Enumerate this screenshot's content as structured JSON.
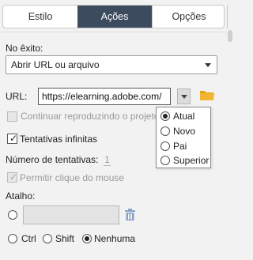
{
  "tabs": [
    {
      "label": "Estilo"
    },
    {
      "label": "Ações"
    },
    {
      "label": "Opções"
    }
  ],
  "on_success": {
    "label": "No êxito:",
    "selected": "Abrir URL ou arquivo"
  },
  "url": {
    "label": "URL:",
    "value": "https://elearning.adobe.com/"
  },
  "continue_playing": {
    "label": "Continuar reproduzindo o projeto"
  },
  "infinite_attempts": {
    "label": "Tentativas infinitas"
  },
  "attempts": {
    "label": "Número de tentativas:",
    "value": "1"
  },
  "allow_mouse_click": {
    "label": "Permitir clique do mouse"
  },
  "shortcut": {
    "label": "Atalho:",
    "modifiers": [
      {
        "label": "Ctrl"
      },
      {
        "label": "Shift"
      },
      {
        "label": "Nenhuma"
      }
    ]
  },
  "window_popup": {
    "options": [
      {
        "label": "Atual"
      },
      {
        "label": "Novo"
      },
      {
        "label": "Pai"
      },
      {
        "label": "Superior"
      }
    ]
  },
  "colors": {
    "active_tab": "#3c4b5e",
    "folder": "#e8a317",
    "trash": "#8aa3c2"
  }
}
